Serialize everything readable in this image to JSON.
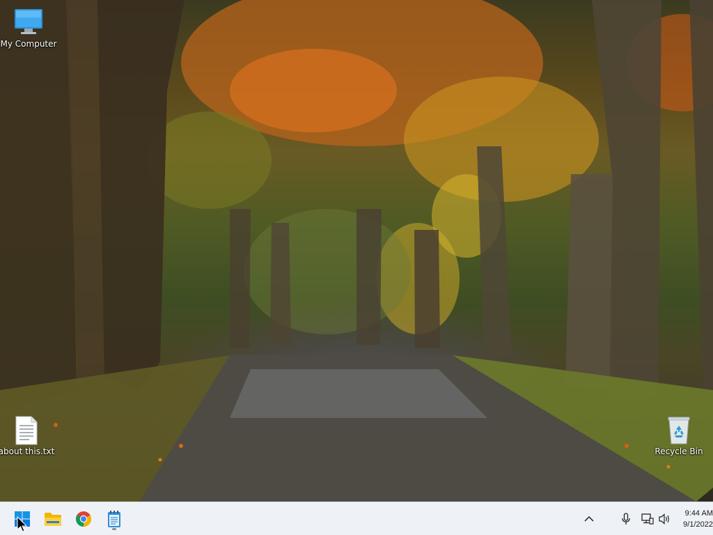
{
  "desktop": {
    "icons": [
      {
        "label": "My Computer",
        "icon": "computer-icon"
      },
      {
        "label": "about this.txt",
        "icon": "text-file-icon"
      },
      {
        "label": "Recycle Bin",
        "icon": "recycle-bin-icon"
      }
    ]
  },
  "taskbar": {
    "apps": [
      {
        "icon": "windows-start-icon"
      },
      {
        "icon": "folder-icon"
      },
      {
        "icon": "chrome-icon"
      },
      {
        "icon": "notepad-icon"
      }
    ],
    "tray": {
      "icons": [
        "chevron-up-icon",
        "microphone-icon",
        "network-icon",
        "speaker-icon"
      ],
      "time": "9:44 AM",
      "date": "9/1/2022"
    }
  },
  "colors": {
    "taskbar_bg": "#eef1f6",
    "windows_blue": "#0a7be0"
  }
}
